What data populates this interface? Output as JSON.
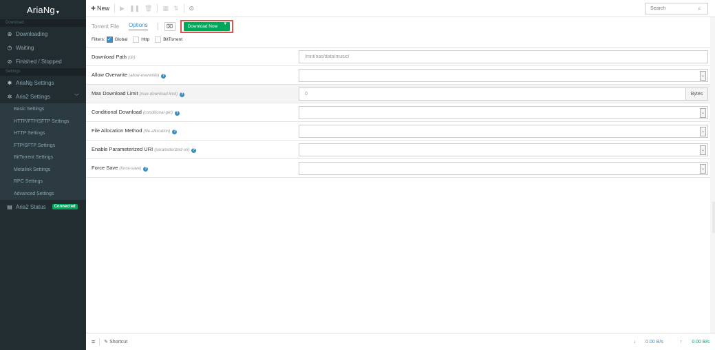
{
  "app": {
    "title": "AriaNg"
  },
  "sidebar": {
    "section_download": "Download",
    "downloading": "Downloading",
    "waiting": "Waiting",
    "finished": "Finished / Stopped",
    "section_settings": "Settings",
    "ariang_settings": "AriaNg Settings",
    "aria2_settings": "Aria2 Settings",
    "sub_items": [
      "Basic Settings",
      "HTTP/FTP/SFTP Settings",
      "HTTP Settings",
      "FTP/SFTP Settings",
      "BitTorrent Settings",
      "Metalink Settings",
      "RPC Settings",
      "Advanced Settings"
    ],
    "aria2_status": "Aria2 Status",
    "status_badge": "Connected"
  },
  "toolbar": {
    "new_label": "New",
    "search_placeholder": "Search"
  },
  "tabs": {
    "torrent_file": "Torrent File",
    "options": "Options"
  },
  "download_now": "Download Now",
  "filters": {
    "label": "Filters:",
    "global": "Global",
    "http": "Http",
    "bittorrent": "BitTorrent"
  },
  "options": [
    {
      "label": "Download Path",
      "key": "(dir)",
      "help": false,
      "type": "text",
      "value": "/mnt/nas/data/music/"
    },
    {
      "label": "Allow Overwrite",
      "key": "(allow-overwrite)",
      "help": true,
      "type": "select",
      "value": ""
    },
    {
      "label": "Max Download Limit",
      "key": "(max-download-limit)",
      "help": true,
      "type": "unit",
      "value": "0",
      "unit": "Bytes"
    },
    {
      "label": "Conditional Download",
      "key": "(conditional-get)",
      "help": true,
      "type": "select",
      "value": ""
    },
    {
      "label": "File Allocation Method",
      "key": "(file-allocation)",
      "help": true,
      "type": "select",
      "value": ""
    },
    {
      "label": "Enable Parameterized URI",
      "key": "(parameterized-uri)",
      "help": true,
      "type": "select",
      "value": ""
    },
    {
      "label": "Force Save",
      "key": "(force-save)",
      "help": true,
      "type": "select",
      "value": ""
    }
  ],
  "footer": {
    "shortcut": "Shortcut",
    "download_speed": "0.00 B/s",
    "upload_speed": "0.00 B/s"
  }
}
